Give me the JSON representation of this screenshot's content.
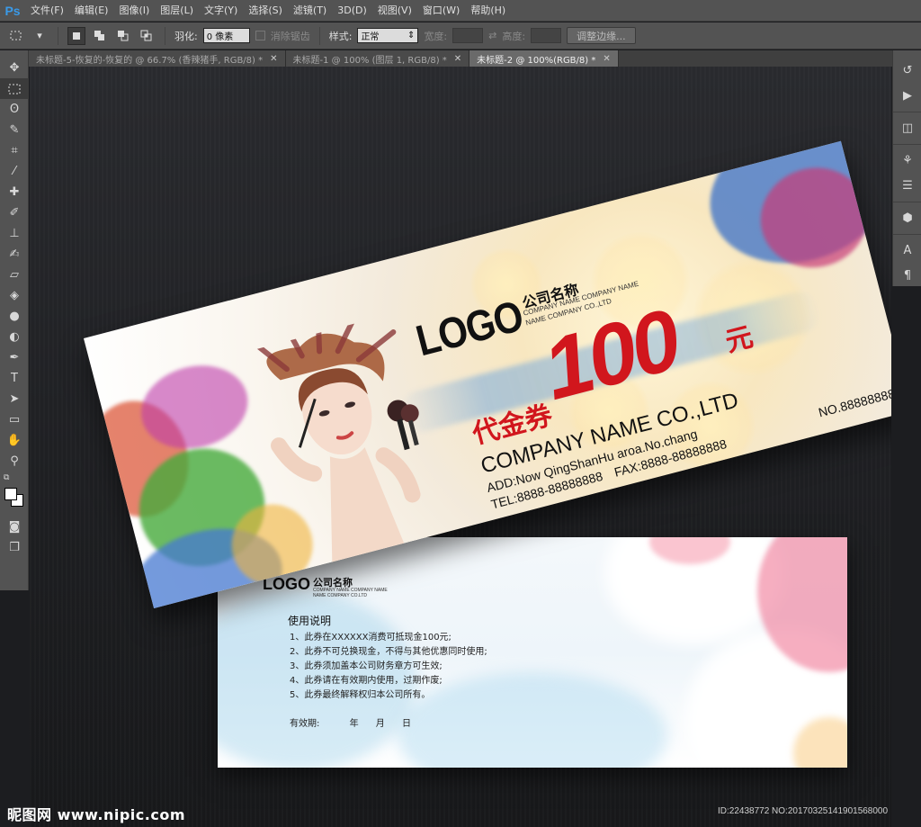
{
  "app": {
    "logo": "Ps",
    "menu": [
      "文件(F)",
      "编辑(E)",
      "图像(I)",
      "图层(L)",
      "文字(Y)",
      "选择(S)",
      "滤镜(T)",
      "3D(D)",
      "视图(V)",
      "窗口(W)",
      "帮助(H)"
    ]
  },
  "options": {
    "feather_label": "羽化:",
    "feather_value": "0 像素",
    "antialias_label": "消除锯齿",
    "style_label": "样式:",
    "style_value": "正常",
    "width_label": "宽度:",
    "height_label": "高度:",
    "refine_button": "调整边缘..."
  },
  "tabs": [
    {
      "label": "未标题-5-恢复的-恢复的 @ 66.7% (香辣猪手, RGB/8) *",
      "active": false
    },
    {
      "label": "未标题-1 @ 100% (图层 1, RGB/8) *",
      "active": false
    },
    {
      "label": "未标题-2 @ 100%(RGB/8) *",
      "active": true
    }
  ],
  "tools": [
    "move-tool",
    "marquee-tool",
    "lasso-tool",
    "quick-select-tool",
    "crop-tool",
    "eyedropper-tool",
    "healing-tool",
    "brush-tool",
    "stamp-tool",
    "history-brush-tool",
    "eraser-tool",
    "paint-bucket-tool",
    "blur-tool",
    "dodge-tool",
    "pen-tool",
    "type-tool",
    "path-select-tool",
    "shape-tool",
    "hand-tool",
    "zoom-tool"
  ],
  "colors": {
    "accent_red": "#d1161d",
    "canvas_bg": "#1c1d20"
  },
  "voucher_front": {
    "logo": "LOGO",
    "company_cn": "公司名称",
    "company_en_line1": "COMPANY NAME COMPANY NAME",
    "company_en_line2": "NAME COMPANY CO.,LTD",
    "type": "代金券",
    "amount": "100",
    "unit": "元",
    "company_name": "COMPANY NAME CO.,LTD",
    "address": "ADD:Now QingShanHu aroa.No.chang",
    "tel": "TEL:8888-88888888",
    "fax": "FAX:8888-88888888",
    "serial": "NO.88888888"
  },
  "voucher_back": {
    "logo": "LOGO",
    "company_cn": "公司名称",
    "company_en_line1": "COMPANY NAME COMPANY NAME",
    "company_en_line2": "NAME COMPANY CO.LTD",
    "title": "使用说明",
    "rules": [
      "1、此券在XXXXXX消费可抵现金100元;",
      "2、此券不可兑换现金，不得与其他优惠同时使用;",
      "3、此券须加盖本公司财务章方可生效;",
      "4、此券请在有效期内使用，过期作废;",
      "5、此券最终解释权归本公司所有。"
    ],
    "valid_label": "有效期:",
    "year": "年",
    "month": "月",
    "day": "日"
  },
  "footer": {
    "watermark": "昵图网 www.nipic.com",
    "id_text": "ID:22438772 NO:20170325141901568000"
  }
}
